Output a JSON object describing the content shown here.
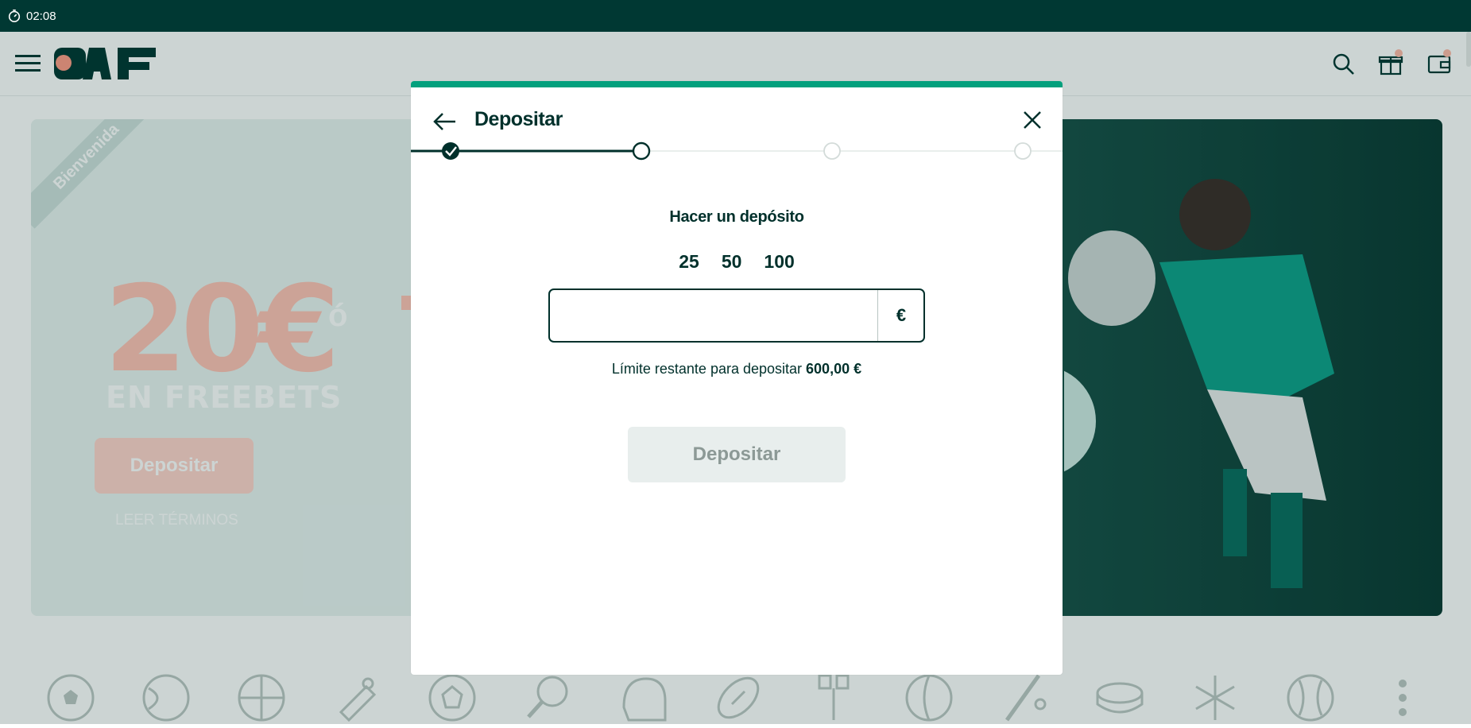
{
  "statusbar": {
    "time": "02:08"
  },
  "header": {
    "logo_text": "PAF",
    "icons": [
      "menu-icon",
      "search-icon",
      "gift-icon",
      "wallet-icon"
    ]
  },
  "hero": {
    "ribbon": "Bienvenida",
    "amount": "20€",
    "amount_sub": "EN FREEBETS",
    "or_text": "ó",
    "button": "Depositar",
    "terms": "LEER TÉRMINOS"
  },
  "modal": {
    "title": "Depositar",
    "steps": {
      "total": 4,
      "current": 2
    },
    "heading": "Hacer un depósito",
    "presets": [
      "25",
      "50",
      "100"
    ],
    "amount_value": "",
    "currency": "€",
    "limit_text": "Límite restante para depositar",
    "limit_value": "600,00 €",
    "submit": "Depositar"
  },
  "sports": [
    "football-icon",
    "tennis-icon",
    "basketball-icon",
    "esports-icon",
    "handball-icon",
    "table-tennis-icon",
    "helmet-icon",
    "american-football-icon",
    "golf-icon",
    "volleyball-icon",
    "cricket-icon",
    "hockey-puck-icon",
    "winter-sports-icon",
    "baseball-icon",
    "more-icon"
  ],
  "colors": {
    "brand_dark": "#003833",
    "accent_green": "#03a07d",
    "peach": "#ffc2b4"
  }
}
